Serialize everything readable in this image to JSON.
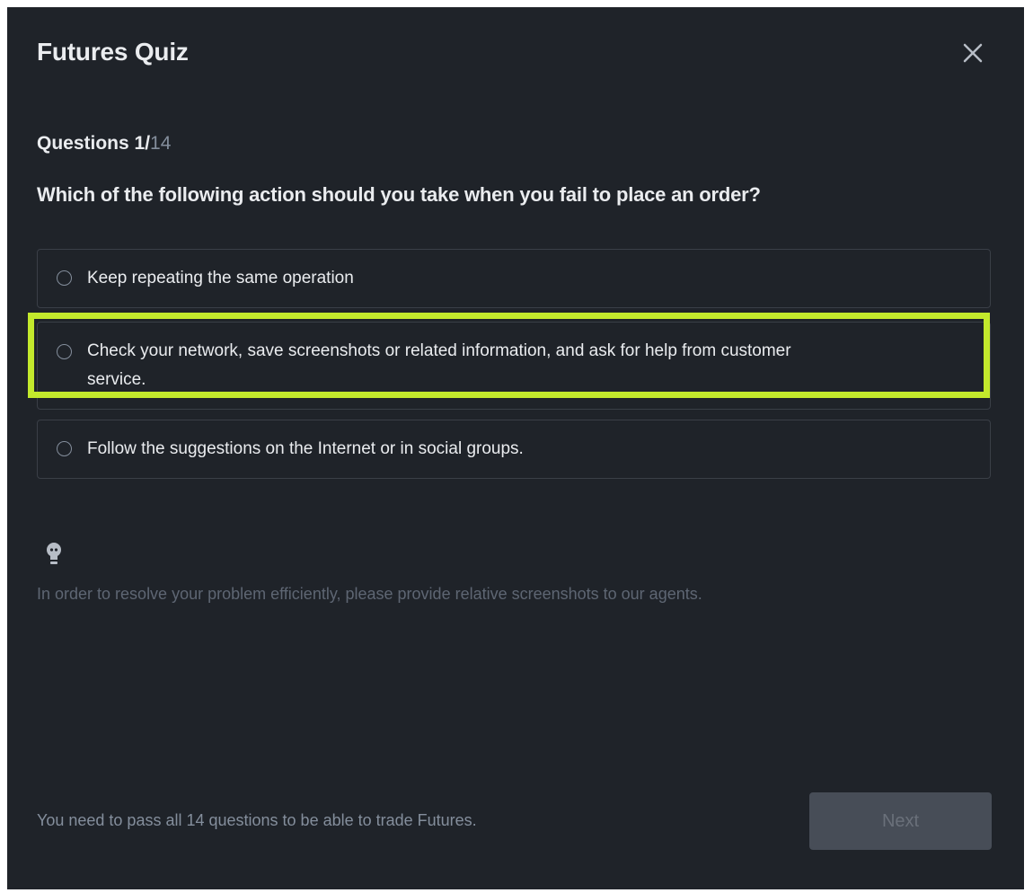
{
  "modal": {
    "title": "Futures Quiz",
    "close_icon": "close-icon"
  },
  "quiz": {
    "counter_prefix": "Questions 1/",
    "counter_total": "14",
    "question": "Which of the following action should you take when you fail to place an order?",
    "options": [
      {
        "label": "Keep repeating the same operation"
      },
      {
        "label": "Check your network, save screenshots or related information, and ask for help from customer service."
      },
      {
        "label": "Follow the suggestions on the Internet or in social groups."
      }
    ],
    "hint_icon": "lightbulb-icon",
    "hint": "In order to resolve your problem efficiently, please provide relative screenshots to our agents."
  },
  "footer": {
    "note": "You need to pass all 14 questions to be able to trade Futures.",
    "next_label": "Next"
  },
  "colors": {
    "background": "#1f2329",
    "text_primary": "#eaecef",
    "text_muted": "#5e6673",
    "option_border": "#3a3f47",
    "highlight": "#c3e92c",
    "button_disabled": "#474d57"
  }
}
